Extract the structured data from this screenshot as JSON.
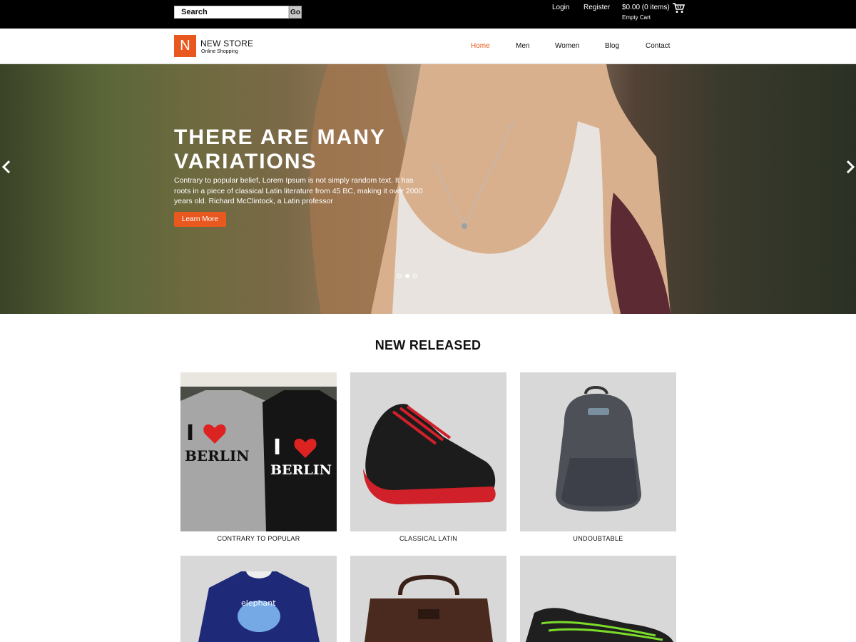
{
  "topbar": {
    "search_placeholder": "Search",
    "go_label": "Go",
    "login_label": "Login",
    "register_label": "Register",
    "cart_amount": "$0.00 (0 items)",
    "cart_sub": "Empty Cart"
  },
  "header": {
    "logo_letter": "N",
    "logo_title": "NEW STORE",
    "logo_subtitle": "Online Shopping",
    "nav": [
      "Home",
      "Men",
      "Women",
      "Blog",
      "Contact"
    ],
    "active_nav": "Home"
  },
  "hero": {
    "title": "THERE ARE MANY VARIATIONS",
    "text": "Contrary to popular belief, Lorem Ipsum is not simply random text. It has roots in a piece of classical Latin literature from 45 BC, making it over 2000 years old. Richard McClintock, a Latin professor",
    "button_label": "Learn More",
    "slide_count": 3,
    "active_slide": 2
  },
  "section": {
    "title": "NEW RELEASED"
  },
  "products": [
    {
      "caption": "CONTRARY TO POPULAR",
      "image": "tshirts-berlin"
    },
    {
      "caption": "CLASSICAL LATIN",
      "image": "sneaker-black-red"
    },
    {
      "caption": "UNDOUBTABLE",
      "image": "backpack-grey"
    },
    {
      "caption": "",
      "image": "tshirt-elephant"
    },
    {
      "caption": "",
      "image": "leather-bag"
    },
    {
      "caption": "",
      "image": "sneaker-black-green"
    }
  ],
  "colors": {
    "accent": "#e8581f",
    "topbar": "#000000",
    "card_bg": "#d8d8d8"
  }
}
